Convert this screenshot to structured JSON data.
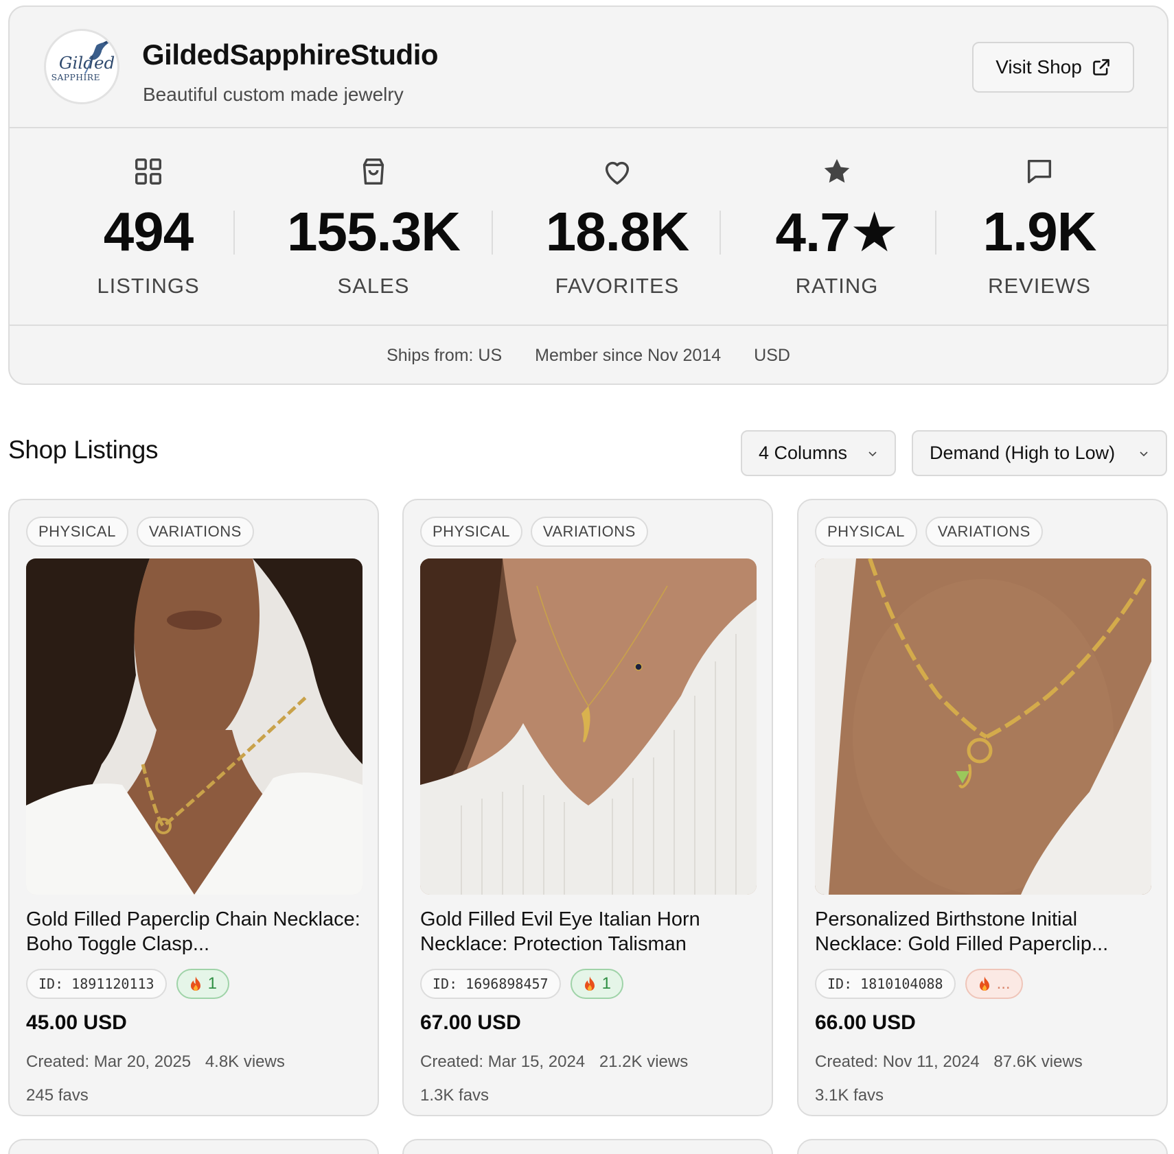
{
  "shop": {
    "name": "GildedSapphireStudio",
    "tagline": "Beautiful custom made jewelry",
    "logo_text_top": "Gilded",
    "logo_text_bottom": "SAPPHIRE",
    "visit_label": "Visit Shop"
  },
  "stats": [
    {
      "icon": "grid-icon",
      "value": "494",
      "label": "LISTINGS"
    },
    {
      "icon": "shopping-bag-icon",
      "value": "155.3K",
      "label": "SALES"
    },
    {
      "icon": "heart-icon",
      "value": "18.8K",
      "label": "FAVORITES"
    },
    {
      "icon": "star-icon",
      "value": "4.7★",
      "label": "RATING"
    },
    {
      "icon": "message-icon",
      "value": "1.9K",
      "label": "REVIEWS"
    }
  ],
  "meta": {
    "ships_from": "Ships from: US",
    "member_since": "Member since Nov 2014",
    "currency": "USD"
  },
  "listings": {
    "title": "Shop Listings",
    "columns_select": "4 Columns",
    "sort_select": "Demand (High to Low)",
    "items": [
      {
        "tags": [
          "PHYSICAL",
          "VARIATIONS"
        ],
        "title": "Gold Filled Paperclip Chain Necklace: Boho Toggle Clasp...",
        "id": "ID: 1891120113",
        "hot": "1",
        "price": "45.00 USD",
        "created": "Created: Mar 20, 2025",
        "views": "4.8K views",
        "favs": "245 favs"
      },
      {
        "tags": [
          "PHYSICAL",
          "VARIATIONS"
        ],
        "title": "Gold Filled Evil Eye Italian Horn Necklace: Protection Talisman",
        "id": "ID: 1696898457",
        "hot": "1",
        "price": "67.00 USD",
        "created": "Created: Mar 15, 2024",
        "views": "21.2K views",
        "favs": "1.3K favs"
      },
      {
        "tags": [
          "PHYSICAL",
          "VARIATIONS"
        ],
        "title": "Personalized Birthstone Initial Necklace: Gold Filled Paperclip...",
        "id": "ID: 1810104088",
        "hot": "...",
        "price": "66.00 USD",
        "created": "Created: Nov 11, 2024",
        "views": "87.6K views",
        "favs": "3.1K favs"
      }
    ]
  },
  "colors": {
    "card_bg": "#f4f4f4",
    "border": "#dcdcdc",
    "hot_green": "#2f8f43",
    "hot_peach": "#d9846a",
    "flame": "#e8501c"
  }
}
